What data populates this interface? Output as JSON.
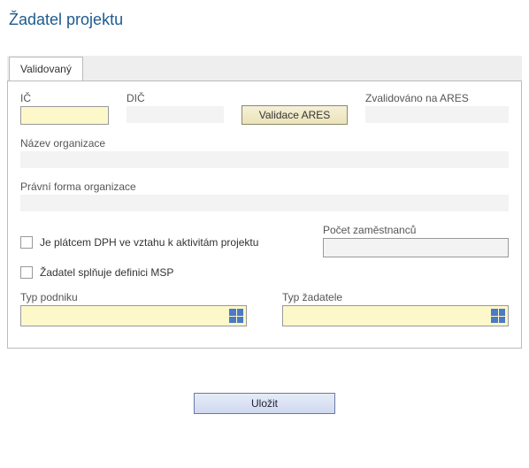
{
  "page": {
    "title": "Žadatel projektu"
  },
  "tabs": {
    "validated": "Validovaný"
  },
  "fields": {
    "ic_label": "IČ",
    "ic_value": "",
    "dic_label": "DIČ",
    "dic_value": "",
    "validate_ares_btn": "Validace ARES",
    "validated_on_ares_label": "Zvalidováno na ARES",
    "validated_on_ares_value": "",
    "org_name_label": "Název organizace",
    "org_name_value": "",
    "legal_form_label": "Právní forma organizace",
    "legal_form_value": "",
    "vat_payer_label": "Je plátcem DPH ve vztahu k aktivitám projektu",
    "employees_label": "Počet zaměstnanců",
    "employees_value": "",
    "msp_label": "Žadatel splňuje definici MSP",
    "company_type_label": "Typ podniku",
    "company_type_value": "",
    "applicant_type_label": "Typ žadatele",
    "applicant_type_value": ""
  },
  "actions": {
    "save": "Uložit"
  }
}
